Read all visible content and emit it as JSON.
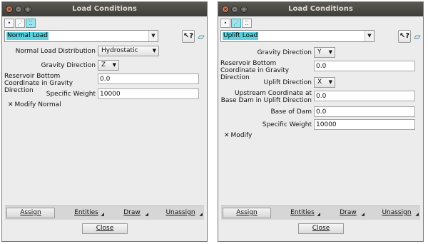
{
  "left": {
    "title": "Load Conditions",
    "load_type": "Normal Load",
    "fields": {
      "distribution": {
        "label": "Normal Load Distribution",
        "value": "Hydrostatic"
      },
      "gravity": {
        "label": "Gravity Direction",
        "value": "Z"
      },
      "reservoir": {
        "label": "Reservoir Bottom Coordinate in Gravity Direction",
        "value": "0.0"
      },
      "weight": {
        "label": "Specific Weight",
        "value": "10000"
      }
    },
    "checkbox": {
      "mark": "✕",
      "label": "Modify Normal"
    },
    "bottom": {
      "assign": "Assign",
      "entities": "Entities",
      "draw": "Draw",
      "unassign": "Unassign"
    },
    "close": "Close"
  },
  "right": {
    "title": "Load Conditions",
    "load_type": "Uplift Load",
    "fields": {
      "gravity": {
        "label": "Gravity Direction",
        "value": "Y"
      },
      "reservoir": {
        "label": "Reservoir Bottom Coordinate in Gravity Direction",
        "value": "0.0"
      },
      "uplift": {
        "label": "Uplift Direction",
        "value": "X"
      },
      "upstream": {
        "label": "Upstream Coordinate at Base Dam in Uplift Direction",
        "value": "0.0"
      },
      "base": {
        "label": "Base of Dam",
        "value": "0.0"
      },
      "weight": {
        "label": "Specific Weight",
        "value": "10000"
      }
    },
    "checkbox": {
      "mark": "✕",
      "label": "Modify"
    },
    "bottom": {
      "assign": "Assign",
      "entities": "Entities",
      "draw": "Draw",
      "unassign": "Unassign"
    },
    "close": "Close"
  },
  "icons": {
    "close": "close-icon",
    "minimize": "minimize-icon",
    "maximize": "maximize-icon",
    "point": "point-entity-icon",
    "line": "line-entity-icon",
    "surface": "surface-entity-icon",
    "help": "help-icon",
    "copy": "copy-icon"
  }
}
